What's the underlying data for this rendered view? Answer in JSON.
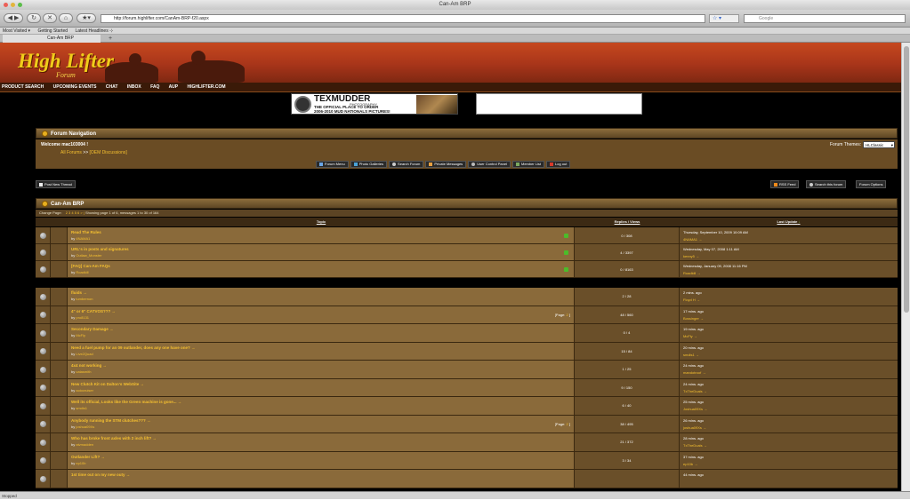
{
  "window": {
    "title": "Can-Am BRP"
  },
  "browser": {
    "url": "http://forum.highlifter.com/CanAm-BRP-f20.aspx",
    "search_placeholder": "Google",
    "bookmarks": [
      "Most Visited ▾",
      "Getting Started",
      "Latest Headlines ⊹"
    ],
    "tab_label": "Can-Am BRP",
    "new_tab": "+",
    "status": "Stopped"
  },
  "site": {
    "logo_main": "High Lifter",
    "logo_sub": "Forum",
    "menu": [
      "PRODUCT SEARCH",
      "UPCOMING EVENTS",
      "CHAT",
      "INBOX",
      "FAQ",
      "AUP",
      "HIGHLIFTER.COM"
    ],
    "ad_text": {
      "brand": "TEXMUDDER",
      "sub": "PHOTOGRAPHY",
      "line1": "THE OFFICIAL PLACE TO ORDER",
      "line2": "2006-2010 MUD NATIONALS PICTURES!"
    }
  },
  "nav": {
    "header": "Forum Navigation",
    "welcome": "Welcome mac103004 !",
    "breadcrumb_all": "All Forums",
    "breadcrumb_sep": ">>",
    "breadcrumb_current": "[OEM Discussions]",
    "themes_label": "Forum Themes:",
    "theme_value": "HLClassic",
    "buttons": [
      "Forum Menu",
      "Photo Galleries",
      "Search Forum",
      "Private Messages",
      "User Control Panel",
      "Member List",
      "Log out"
    ]
  },
  "toolbar": {
    "new_thread": "Post New Thread",
    "rss": "RSS Feed",
    "search_forum": "Search this forum",
    "options": "Forum Options"
  },
  "forum": {
    "title": "Can-Am BRP",
    "change_page": "Change Page:",
    "pages": "2 3 4 5 6 > |",
    "page_info": "Showing page 1 of 6, messages 1 to 30 of 164",
    "col_topic": "Topic",
    "col_rv": "Replies / Views",
    "col_lu": "Last Update"
  },
  "sticky": [
    {
      "title": "Read The Rules",
      "by": "by",
      "author": "4NAMA1",
      "rv": "0 / 308",
      "date": "Thursday, September 10, 2009 10:09 AM",
      "last": "4NAMA1 →"
    },
    {
      "title": "URL's in posts and signatures",
      "by": "by",
      "author": "Outlaw_Monster",
      "rv": "4 / 3397",
      "date": "Wednesday, May 07, 2008 1:11 AM",
      "last": "kenny5 →"
    },
    {
      "title": "[FAQ] Can-Am FAQs",
      "by": "by",
      "author": "Roadkill",
      "rv": "0 / 8163",
      "date": "Wednesday, January 09, 2008 11:16 PM",
      "last": "Roadkill →"
    }
  ],
  "topics": [
    {
      "title": "fluids →",
      "author": "tumbernon",
      "rv": "2 / 28",
      "ago": "2 mins. ago",
      "last": "Floyd H →",
      "pages": ""
    },
    {
      "title": "4\" or 6\" CATVOS??? →",
      "author": "pro8131",
      "rv": "48 / 560",
      "ago": "17 mins. ago",
      "last": "Bossinger →",
      "pages": "2"
    },
    {
      "title": "Secondary Damage →",
      "author": "McFly",
      "rv": "0 / 4",
      "ago": "19 mins. ago",
      "last": "McFly →",
      "pages": ""
    },
    {
      "title": "Need a fuel pump for an 09 outlander, does any one have one? →",
      "author": "Live2Quad",
      "rv": "15 / 84",
      "ago": "20 mins. ago",
      "last": "smdis1 →",
      "pages": ""
    },
    {
      "title": "4x4 not working →",
      "author": "catasmith",
      "rv": "1 / 25",
      "ago": "24 mins. ago",
      "last": "mandotroof →",
      "pages": ""
    },
    {
      "title": "New Clutch Kit on Dalton's WebSite →",
      "author": "aoiocruiser",
      "rv": "9 / 150",
      "ago": "24 mins. ago",
      "last": "TxTheDuals →",
      "pages": ""
    },
    {
      "title": "Well its official, Looks like the Green machine is gone... →",
      "author": "smdis1",
      "rv": "6 / 40",
      "ago": "25 mins. ago",
      "last": "Joshua09Xs →",
      "pages": ""
    },
    {
      "title": "Anybody running the STM clutches??? →",
      "author": "joshua09Xs",
      "rv": "38 / 495",
      "ago": "26 mins. ago",
      "last": "joshua09Xs →",
      "pages": "2"
    },
    {
      "title": "Who has broke front axles with 2 inch lift? →",
      "author": "atvmadden",
      "rv": "21 / 372",
      "ago": "28 mins. ago",
      "last": "TxTheDuals →",
      "pages": ""
    },
    {
      "title": "Outlander Lift? →",
      "author": "ep10b",
      "rv": "3 / 34",
      "ago": "37 mins. ago",
      "last": "ep10b →",
      "pages": ""
    },
    {
      "title": "1st time out on my new outy →",
      "author": "",
      "rv": "",
      "ago": "44 mins. ago",
      "last": "",
      "pages": ""
    }
  ],
  "page_prefix": "[Page:",
  "page_suffix": "]"
}
